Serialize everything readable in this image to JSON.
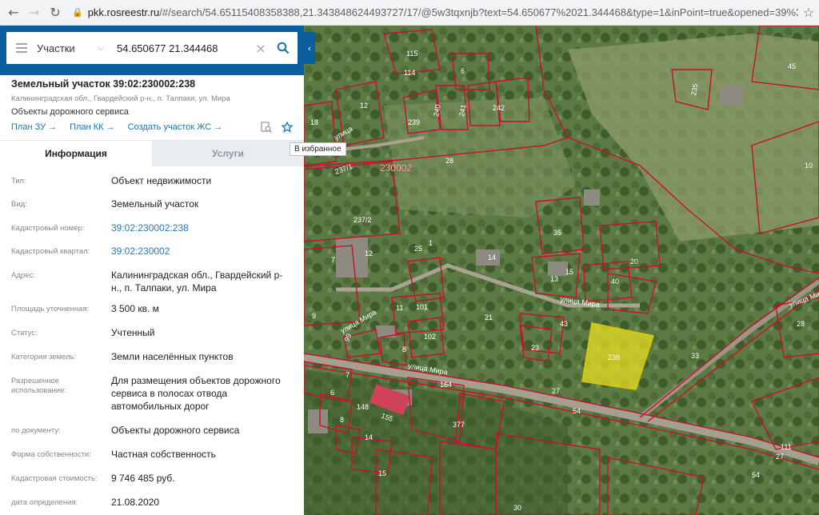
{
  "browser": {
    "url_host": "pkk.rosreestr.ru",
    "url_rest": "/#/search/54.65115408358388,21.343848624493727/17/@5w3tqxnjb?text=54.650677%2021.344468&type=1&inPoint=true&opened=39%3A2%3A2..."
  },
  "search": {
    "type_label": "Участки",
    "query": "54.650677 21.344468"
  },
  "parcel": {
    "title": "Земельный участок 39:02:230002:238",
    "address": "Калининградская обл., Гвардейский р-н., п. Талпаки, ул. Мира",
    "purpose": "Объекты дорожного сервиса",
    "links": [
      "План ЗУ →",
      "План КК →",
      "Создать участок ЖС →"
    ],
    "tooltip": "В избранное"
  },
  "tabs": [
    "Информация",
    "Услуги"
  ],
  "info_rows": [
    {
      "label": "Тип:",
      "value": "Объект недвижимости"
    },
    {
      "label": "Вид:",
      "value": "Земельный участок"
    },
    {
      "label": "Кадастровый номер:",
      "value": "39:02:230002:238",
      "link": true
    },
    {
      "label": "Кадастровый квартал:",
      "value": "39:02:230002",
      "link": true
    },
    {
      "label": "Адрес:",
      "value": "Калининградская обл., Гвардейский р-н., п. Талпаки, ул. Мира"
    },
    {
      "label": "Площадь уточненная:",
      "value": "3 500 кв. м"
    },
    {
      "label": "Статус:",
      "value": "Учтенный"
    },
    {
      "label": "Категория земель:",
      "value": "Земли населённых пунктов"
    },
    {
      "label": "Разрешенное использование:",
      "value": "Для размещения объектов дорожного сервиса в полосах отвода автомобильных дорог"
    },
    {
      "label": "по документу:",
      "value": "Объекты дорожного сервиса"
    },
    {
      "label": "Форма собственности:",
      "value": "Частная собственность"
    },
    {
      "label": "Кадастровая стоимость:",
      "value": "9 746 485 руб."
    },
    {
      "label": "дата определения:",
      "value": "21.08.2020"
    }
  ],
  "map": {
    "quarter_label": "230002",
    "street_labels": [
      "улица Мира",
      "улица Мира",
      "улица Мира",
      "улица Мира",
      "улица"
    ],
    "parcel_numbers": [
      "115",
      "114",
      "6",
      "45",
      "12",
      "18",
      "239",
      "240",
      "241",
      "242",
      "235",
      "237/1",
      "28",
      "237/2",
      "35",
      "7",
      "12",
      "25",
      "1",
      "14",
      "13",
      "15",
      "20",
      "40",
      "11",
      "101",
      "21",
      "99",
      "43",
      "102",
      "8",
      "23",
      "238",
      "33",
      "164",
      "7",
      "6",
      "148",
      "155",
      "377",
      "8",
      "14",
      "15",
      "30",
      "27",
      "54",
      "111",
      "27",
      "54",
      "28",
      "9",
      "10"
    ]
  },
  "colors": {
    "brand": "#0b5e9c",
    "link": "#2b79b5",
    "boundary": "#c8102e",
    "selected": "#e8e020"
  }
}
